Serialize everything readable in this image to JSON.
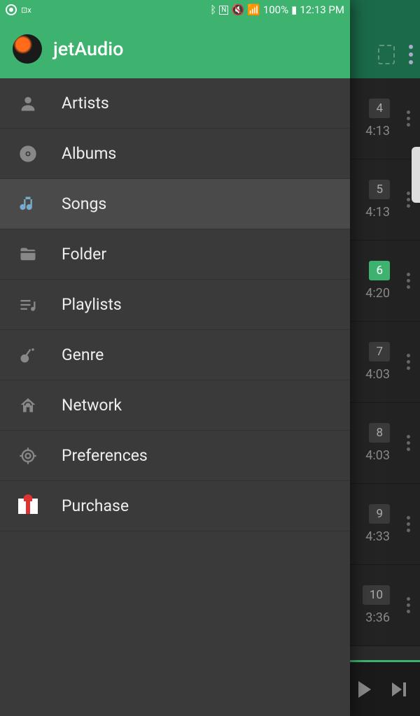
{
  "status_bar": {
    "battery": "100%",
    "time": "12:13 PM"
  },
  "app": {
    "title": "jetAudio"
  },
  "drawer": {
    "items": [
      {
        "label": "Artists",
        "icon": "person-icon",
        "selected": false
      },
      {
        "label": "Albums",
        "icon": "disc-icon",
        "selected": false
      },
      {
        "label": "Songs",
        "icon": "music-note-icon",
        "selected": true
      },
      {
        "label": "Folder",
        "icon": "folder-icon",
        "selected": false
      },
      {
        "label": "Playlists",
        "icon": "playlist-icon",
        "selected": false
      },
      {
        "label": "Genre",
        "icon": "guitar-icon",
        "selected": false
      },
      {
        "label": "Network",
        "icon": "network-icon",
        "selected": false
      },
      {
        "label": "Preferences",
        "icon": "gear-icon",
        "selected": false
      },
      {
        "label": "Purchase",
        "icon": "gift-icon",
        "selected": false
      }
    ]
  },
  "background_tracks": [
    {
      "number": "4",
      "duration": "4:13",
      "active": false
    },
    {
      "number": "5",
      "duration": "4:13",
      "active": false
    },
    {
      "number": "6",
      "duration": "4:20",
      "active": true
    },
    {
      "number": "7",
      "duration": "4:03",
      "active": false
    },
    {
      "number": "8",
      "duration": "4:03",
      "active": false
    },
    {
      "number": "9",
      "duration": "4:33",
      "active": false
    },
    {
      "number": "10",
      "duration": "3:36",
      "active": false
    }
  ]
}
